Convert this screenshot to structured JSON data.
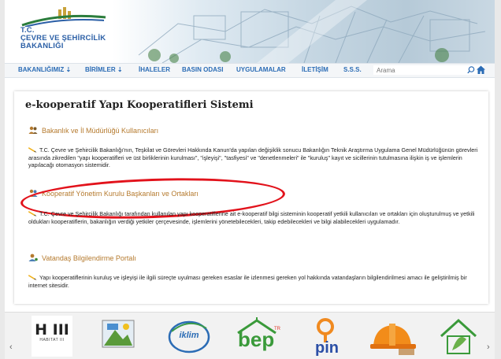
{
  "header": {
    "logo_lines": [
      "T.C.",
      "ÇEVRE VE ŞEHİRCİLİK",
      "BAKANLIĞI"
    ]
  },
  "nav": {
    "items": [
      {
        "label": "BAKANLIĞIMIZ ⇣"
      },
      {
        "label": "BİRİMLER ⇣"
      },
      {
        "label": "İHALELER"
      },
      {
        "label": "BASIN ODASI"
      },
      {
        "label": "UYGULAMALAR"
      },
      {
        "label": "İLETİŞİM"
      },
      {
        "label": "S.S.S."
      }
    ],
    "search_placeholder": "Arama"
  },
  "main": {
    "title": "e-kooperatif Yapı Kooperatifleri Sistemi",
    "sections": [
      {
        "heading": "Bakanlık ve İl Müdürlüğü Kullanıcıları",
        "text": "T.C. Çevre ve Şehircilik Bakanlığı'nın, Teşkilat ve Görevleri Hakkında Kanun'da yapılan değişiklik sonucu Bakanlığın Teknik Araştırma Uygulama Genel Müdürlüğünün görevleri arasında zikredilen \"yapı kooperatifleri ve üst birliklerinin kurulması\", \"işleyişi\", \"tasfiyesi\" ve \"denetlenmeleri\" ile \"kuruluş\" kayıt ve sicillerinin tutulmasına ilişkin iş ve işlemlerin yapılacağı otomasyon sistemidir."
      },
      {
        "heading": "Kooperatif Yönetim Kurulu Başkanları ve Ortakları",
        "text": "T.C. Çevre ve Şehircilik Bakanlığı tarafından kullanılan yapı kooperatiflerine ait e-kooperatif bilgi sisteminin kooperatif yetkili kullanıcıları ve ortakları için oluşturulmuş ve yetkili oldukları kooperatiflerin, bakanlığın verdiği yetkiler çerçevesinde, işlemlerini yönetebilecekleri, takip edebilecekleri ve bilgi alabilecekleri uygulamadır."
      },
      {
        "heading": "Vatandaş Bilgilendirme Portalı",
        "text": "Yapı kooperatiflerinin kuruluş ve işleyişi ile ilgili süreçte uyulması gereken esaslar ile izlenmesi gereken yol hakkında vatandaşların bilgilendirilmesi amacı ile geliştirilmiş bir internet sitesidir."
      }
    ]
  },
  "carousel": {
    "prev": "‹",
    "next": "›",
    "logos": [
      {
        "main": "H III",
        "sub": "HABITAT III"
      },
      {
        "main": ""
      },
      {
        "main": "iklim"
      },
      {
        "main": "bep",
        "sup": "TR"
      },
      {
        "main": "pin"
      },
      {
        "main": ""
      },
      {
        "main": ""
      }
    ]
  },
  "colors": {
    "nav_link": "#2b6cb5",
    "section_heading": "#b57a2e",
    "annotation_oval": "#e2121b"
  }
}
